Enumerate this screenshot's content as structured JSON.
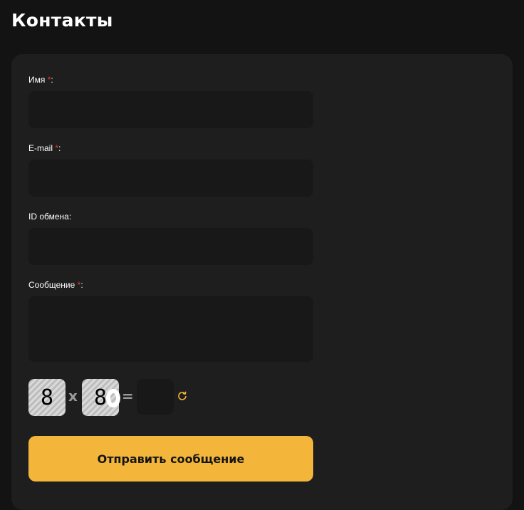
{
  "page": {
    "title": "Контакты"
  },
  "form": {
    "name": {
      "label": "Имя",
      "required_mark": "*",
      "suffix": ":",
      "value": "",
      "placeholder": ""
    },
    "email": {
      "label": "E-mail",
      "required_mark": "*",
      "suffix": ":",
      "value": "",
      "placeholder": ""
    },
    "exchange_id": {
      "label": "ID обмена:",
      "value": "",
      "placeholder": ""
    },
    "message": {
      "label": "Сообщение",
      "required_mark": "*",
      "suffix": ":",
      "value": "",
      "placeholder": ""
    },
    "captcha": {
      "a": "8",
      "operator": "x",
      "b": "8",
      "equals": "=",
      "answer": "",
      "refresh_icon": "refresh-icon"
    },
    "submit_label": "Отправить сообщение"
  },
  "colors": {
    "accent": "#f3b63b",
    "required": "#e53935",
    "background": "#131313",
    "card": "#1e1e1e",
    "input": "#181818"
  }
}
